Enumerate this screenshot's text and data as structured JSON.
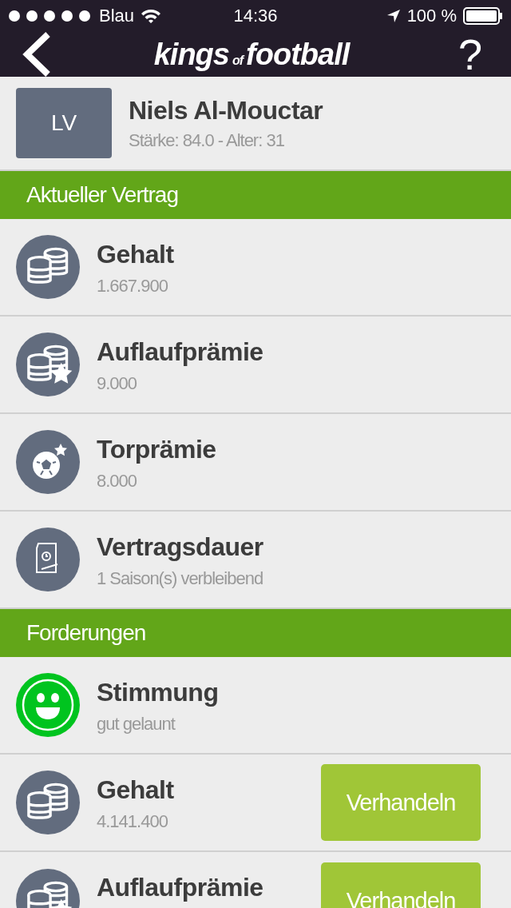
{
  "status_bar": {
    "carrier": "Blau",
    "time": "14:36",
    "battery": "100 %"
  },
  "nav": {
    "logo": [
      "kings",
      "of",
      "football"
    ],
    "help": "?"
  },
  "player": {
    "badge": "LV",
    "name": "Niels Al-Mouctar",
    "details": "Stärke: 84.0 - Alter: 31"
  },
  "sections": [
    {
      "title": "Aktueller Vertrag",
      "rows": [
        {
          "kind": "coins",
          "title": "Gehalt",
          "value": "1.667.900"
        },
        {
          "kind": "bonus",
          "title": "Auflaufprämie",
          "value": "9.000"
        },
        {
          "kind": "goal",
          "title": "Torprämie",
          "value": "8.000"
        },
        {
          "kind": "duration",
          "title": "Vertragsdauer",
          "value": "1 Saison(s) verbleibend"
        }
      ]
    },
    {
      "title": "Forderungen",
      "rows": [
        {
          "kind": "mood",
          "color": "#00c41f",
          "title": "Stimmung",
          "value": "gut gelaunt"
        },
        {
          "kind": "coins",
          "title": "Gehalt",
          "value": "4.141.400",
          "button": "Verhandeln"
        },
        {
          "kind": "bonus",
          "title": "Auflaufprämie",
          "button": "Verhandeln"
        }
      ]
    }
  ]
}
